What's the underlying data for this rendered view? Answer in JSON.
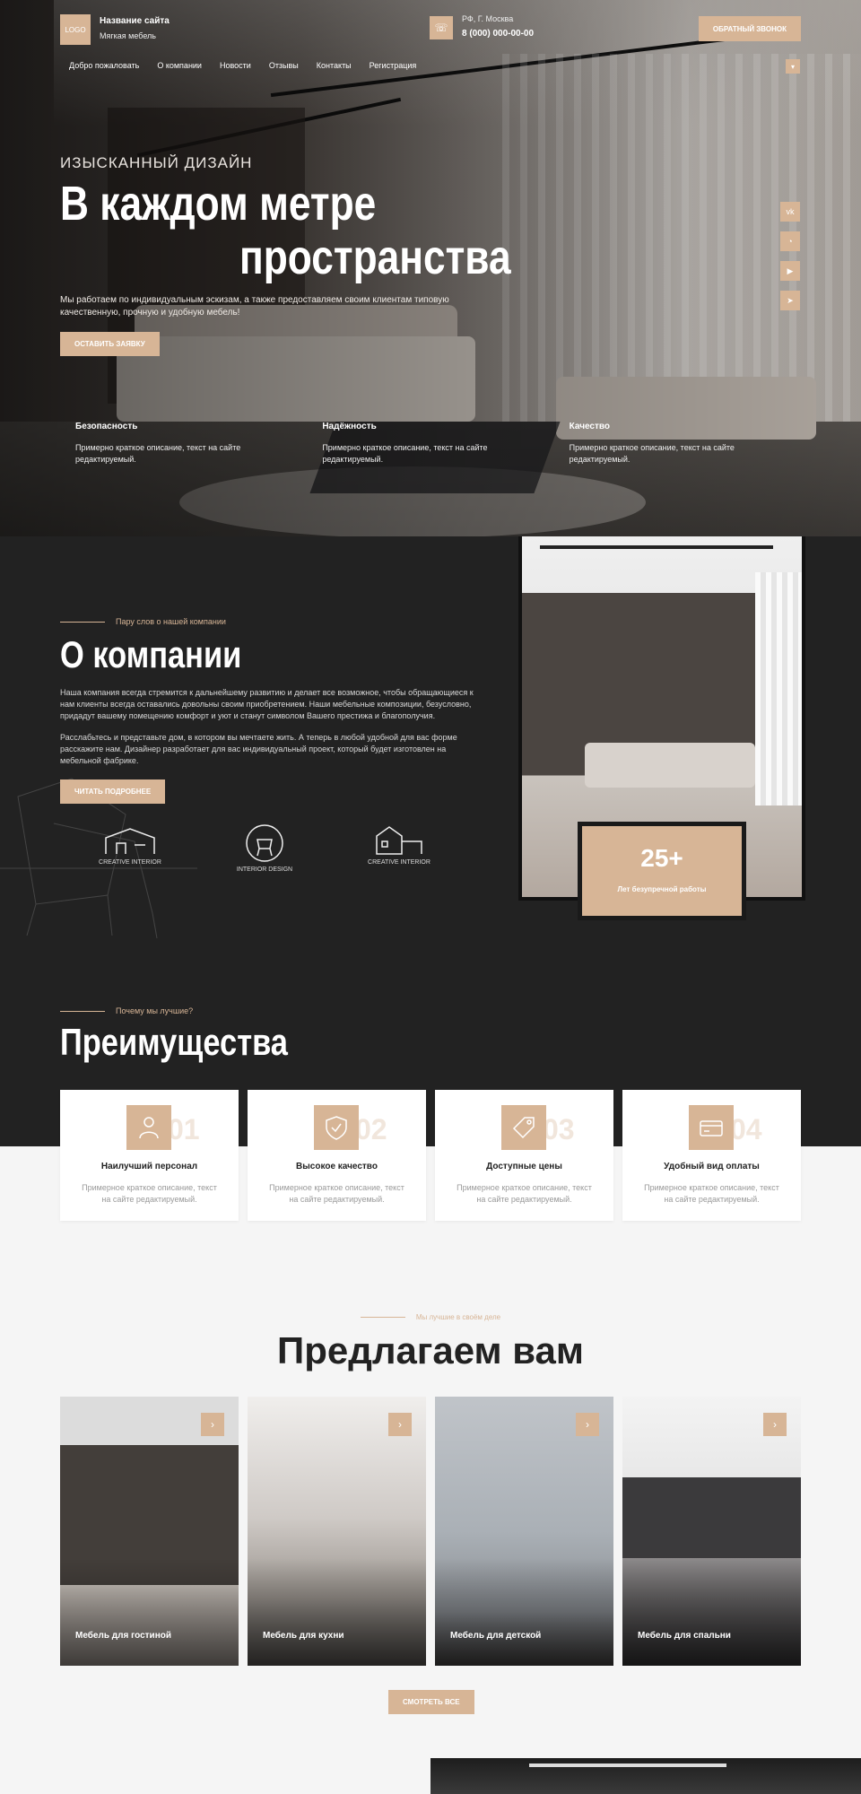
{
  "header": {
    "logo": "LOGO",
    "site_name": "Название сайта",
    "site_sub": "Мягкая мебель",
    "phone_region": "РФ, Г. Москва",
    "phone_number": "8 (000) 000-00-00",
    "callback": "ОБРАТНЫЙ ЗВОНОК",
    "nav": [
      "Добро пожаловать",
      "О компании",
      "Новости",
      "Отзывы",
      "Контакты",
      "Регистрация"
    ]
  },
  "hero": {
    "eyebrow": "ИЗЫСКАННЫЙ ДИЗАЙН",
    "title1": "В каждом метре",
    "title2": "пространства",
    "desc": "Мы работаем по индивидуальным эскизам, а также предоставляем своим клиентам типовую качественную, прочную и удобную мебель!",
    "button": "ОСТАВИТЬ ЗАЯВКУ",
    "socials": [
      "vk-icon",
      "whatsapp-icon",
      "youtube-icon",
      "telegram-icon"
    ],
    "features": [
      {
        "title": "Безопасность",
        "text": "Примерно краткое описание, текст на сайте редактируемый."
      },
      {
        "title": "Надёжность",
        "text": "Примерно краткое описание, текст на сайте редактируемый."
      },
      {
        "title": "Качество",
        "text": "Примерно краткое описание, текст на сайте редактируемый."
      }
    ]
  },
  "about": {
    "eyebrow": "Пару слов о нашей компании",
    "title": "О компании",
    "p1": "Наша компания всегда стремится к дальнейшему развитию и делает все возможное, чтобы обращающиеся к нам клиенты всегда оставались довольны своим приобретением. Наши мебельные композиции, безусловно, придадут вашему помещению комфорт и уют и станут символом Вашего престижа и благополучия.",
    "p2": "Расслабьтесь и представьте дом, в котором вы мечтаете жить. А теперь в любой удобной для вас форме расскажите нам. Дизайнер разработает для вас индивидуальный проект, который будет изготовлен на мебельной фабрике.",
    "button": "ЧИТАТЬ ПОДРОБНЕЕ",
    "brands": [
      "CREATIVE INTERIOR",
      "INTERIOR DESIGN",
      "CREATIVE INTERIOR"
    ],
    "years": "25+",
    "years_label": "Лет безупречной работы"
  },
  "advantages": {
    "eyebrow": "Почему мы лучшие?",
    "title": "Преимущества",
    "cards": [
      {
        "num": "01",
        "title": "Наилучший персонал",
        "text": "Примерное краткое описание, текст на сайте редактируемый.",
        "icon": "staff-icon"
      },
      {
        "num": "02",
        "title": "Высокое качество",
        "text": "Примерное краткое описание, текст на сайте редактируемый.",
        "icon": "quality-shield-icon"
      },
      {
        "num": "03",
        "title": "Доступные цены",
        "text": "Примерное краткое описание, текст на сайте редактируемый.",
        "icon": "price-tag-icon"
      },
      {
        "num": "04",
        "title": "Удобный вид оплаты",
        "text": "Примерное краткое описание, текст на сайте редактируемый.",
        "icon": "credit-card-icon"
      }
    ]
  },
  "offer": {
    "eyebrow": "Мы лучшие в своём деле",
    "title": "Предлагаем вам",
    "cards": [
      "Мебель для гостиной",
      "Мебель для кухни",
      "Мебель для детской",
      "Мебель для спальни"
    ],
    "button": "СМОТРЕТЬ ВСЕ"
  },
  "colors": {
    "accent": "#d7b596",
    "dark": "#222222",
    "light_bg": "#f5f5f5"
  }
}
